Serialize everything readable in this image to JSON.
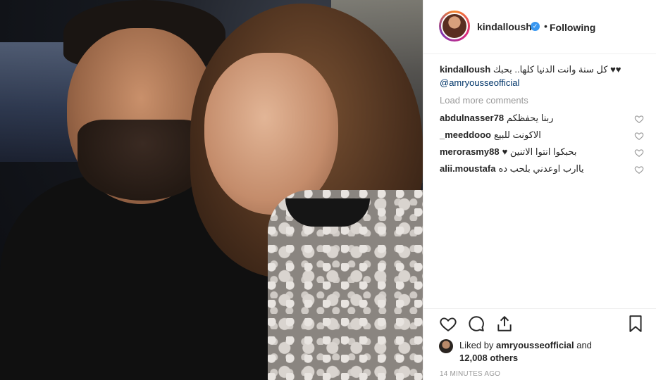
{
  "post": {
    "username": "kindalloush",
    "follow_label": "Following",
    "dot": "•"
  },
  "caption": {
    "username": "kindalloush",
    "text": "♥♥ كل سنة وانت الدنيا كلها.. بحبك",
    "mention": "@amryousseofficial"
  },
  "load_more": "Load more comments",
  "comments": [
    {
      "user": "abdulnasser78",
      "text": "ربنا يحفظكم"
    },
    {
      "user": "_meeddooo",
      "text": "الاكونت للبيع"
    },
    {
      "user": "merorasmy88",
      "text": "♥ بحبكوا انتوا الاتنين"
    },
    {
      "user": "alii.moustafa",
      "text": "ياارب اوعدني بلحب ده"
    }
  ],
  "likes": {
    "prefix": "Liked by",
    "user": "amryousseofficial",
    "and": "and",
    "count": "12,008 others"
  },
  "timestamp": "14 MINUTES AGO",
  "colors": {
    "text": "#262626",
    "muted": "#999999",
    "link": "#003569",
    "verified": "#3897f0",
    "border": "#efefef"
  },
  "icons": {
    "like": "heart-outline-icon",
    "comment": "speech-bubble-icon",
    "share": "share-icon",
    "save": "bookmark-icon",
    "verified": "verified-badge-icon"
  }
}
